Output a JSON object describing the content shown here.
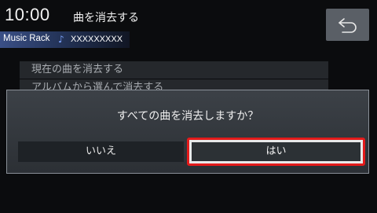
{
  "header": {
    "clock": "10:00",
    "title": "曲を消去する",
    "back_icon": "back-arrow-icon"
  },
  "source": {
    "name": "Music Rack",
    "note_icon": "♪",
    "track": "XXXXXXXXX"
  },
  "menu": {
    "items": [
      {
        "label": "現在の曲を消去する"
      },
      {
        "label": "アルバムから選んで消去する"
      }
    ]
  },
  "dialog": {
    "message": "すべての曲を消去しますか？",
    "no_label": "いいえ",
    "yes_label": "はい"
  },
  "colors": {
    "highlight": "#e41b1b",
    "source_bar": "#3a4f86"
  }
}
